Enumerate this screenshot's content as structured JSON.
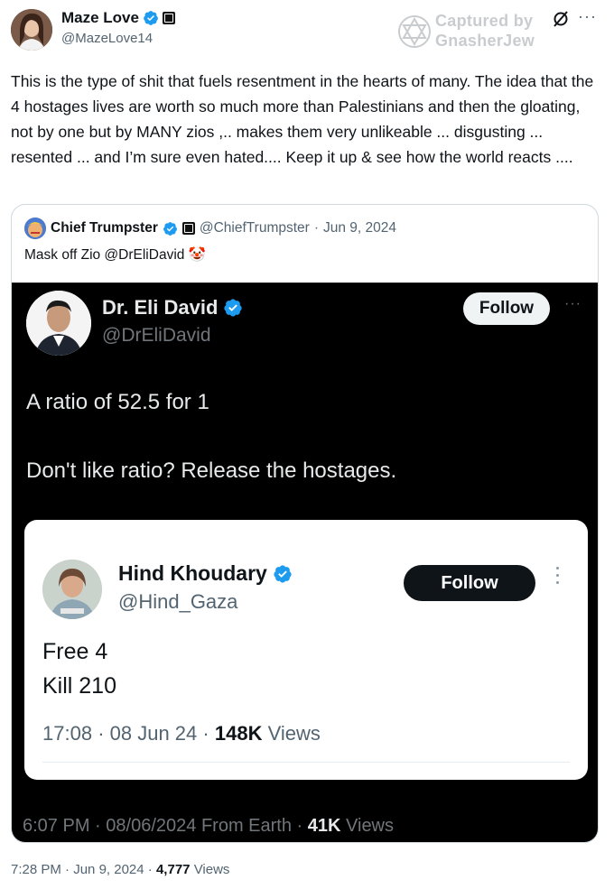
{
  "post": {
    "author_name": "Maze Love",
    "author_handle": "@MazeLove14",
    "text": "This is the type of shit that fuels resentment in the hearts of many.  The idea that the 4 hostages lives are worth so much more than Palestinians and then the gloating, not by one but by MANY zios ,.. makes them very unlikeable ... disgusting ... resented ... and I’m sure even hated.... Keep it up & see how the world reacts ....",
    "time": "7:28 PM",
    "date": "Jun 9, 2024",
    "views_count": "4,777",
    "views_label": "Views"
  },
  "watermark": {
    "line1": "Captured by",
    "line2": "GnasherJew"
  },
  "quote": {
    "author_name": "Chief Trumpster",
    "author_handle": "@ChiefTrumpster",
    "date": "Jun 9, 2024",
    "text": "Mask off Zio @DrEliDavid 🤡"
  },
  "embedded": {
    "author_name": "Dr. Eli David",
    "author_handle": "@DrEliDavid",
    "follow_label": "Follow",
    "line1": "A ratio of 52.5 for 1",
    "line2": "Don't like ratio? Release the hostages.",
    "footer_time": "6:07 PM",
    "footer_date": "08/06/2024",
    "footer_source": "From Earth",
    "footer_views": "41K",
    "footer_views_label": "Views"
  },
  "inner": {
    "author_name": "Hind Khoudary",
    "author_handle": "@Hind_Gaza",
    "follow_label": "Follow",
    "line1": "Free 4",
    "line2": "Kill 210",
    "time": "17:08",
    "date": "08 Jun 24",
    "views_count": "148K",
    "views_label": "Views"
  },
  "colors": {
    "verified": "#1d9bf0",
    "text_primary": "#0f1419",
    "text_secondary": "#536471"
  },
  "icons": [
    "verified-badge-icon",
    "affiliate-badge-icon",
    "star-of-david-icon",
    "grok-icon",
    "more-icon"
  ]
}
